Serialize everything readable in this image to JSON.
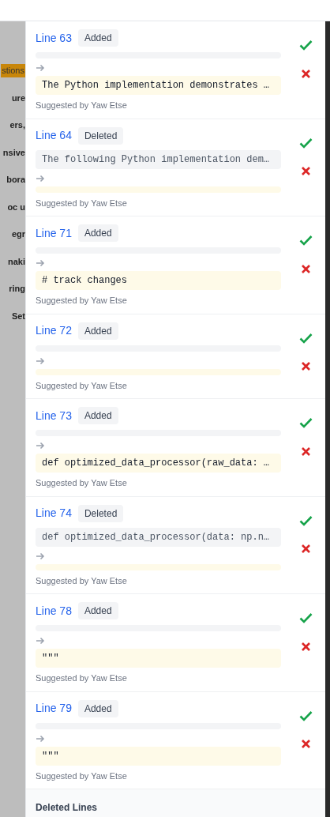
{
  "background_page": {
    "fragments": [
      "stions",
      "ure",
      "ers,",
      "nsive",
      "bora",
      "oc u",
      "egr",
      "naki",
      "ring",
      "Set"
    ]
  },
  "suggestions": [
    {
      "line": "Line 63",
      "status": "Added",
      "new": "The Python implementation demonstrates …",
      "author": "Suggested by Yaw Etse"
    },
    {
      "line": "Line 64",
      "status": "Deleted",
      "old": "The following Python implementation dem…",
      "author": "Suggested by Yaw Etse"
    },
    {
      "line": "Line 71",
      "status": "Added",
      "new": "# track changes",
      "author": "Suggested by Yaw Etse"
    },
    {
      "line": "Line 72",
      "status": "Added",
      "author": "Suggested by Yaw Etse"
    },
    {
      "line": "Line 73",
      "status": "Added",
      "new": "def optimized_data_processor(raw_data: …",
      "author": "Suggested by Yaw Etse"
    },
    {
      "line": "Line 74",
      "status": "Deleted",
      "old": "def optimized_data_processor(data: np.n…",
      "author": "Suggested by Yaw Etse"
    },
    {
      "line": "Line 78",
      "status": "Added",
      "new": "\"\"\"",
      "author": "Suggested by Yaw Etse"
    },
    {
      "line": "Line 79",
      "status": "Added",
      "new": "\"\"\"",
      "author": "Suggested by Yaw Etse"
    }
  ],
  "footer": {
    "title": "Deleted Lines"
  }
}
